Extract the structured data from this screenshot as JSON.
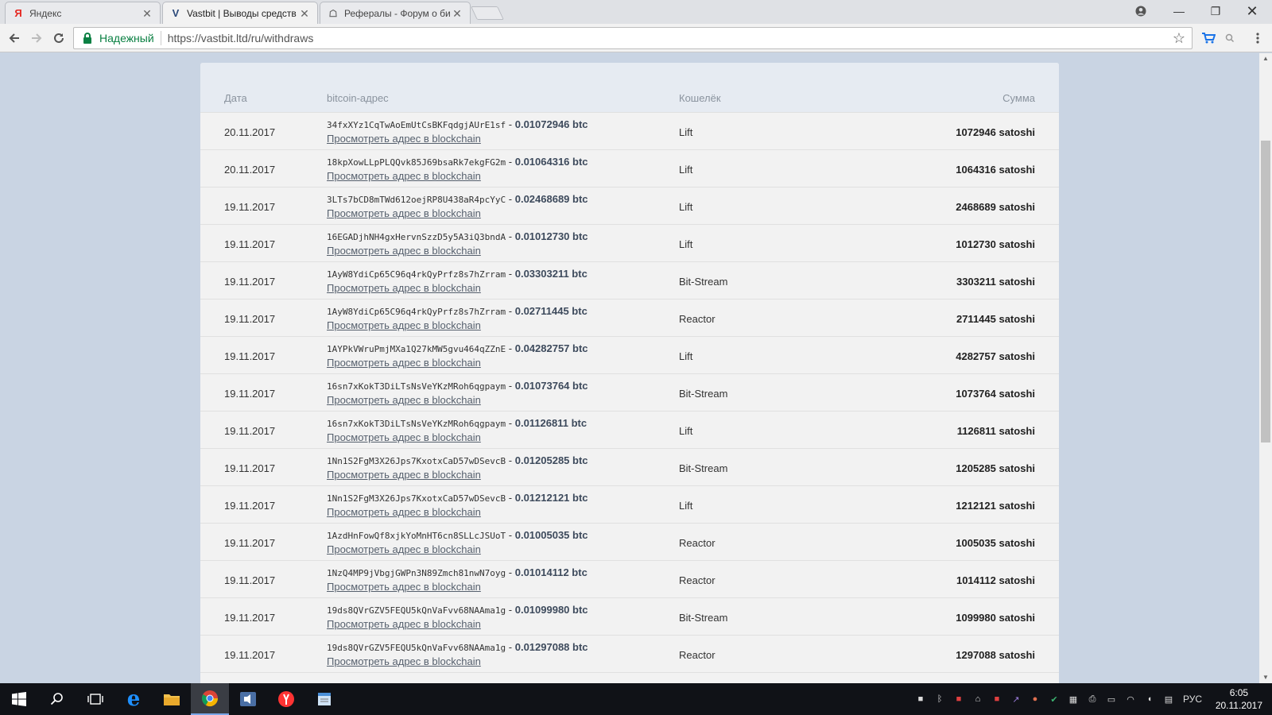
{
  "browser": {
    "tabs": [
      {
        "favicon": "Я",
        "title": "Яндекс"
      },
      {
        "favicon": "V",
        "title": "Vastbit | Выводы средств"
      },
      {
        "favicon": "☖",
        "title": "Рефералы - Форум о би"
      }
    ],
    "secure_label": "Надежный",
    "url": "https://vastbit.ltd/ru/withdraws"
  },
  "table": {
    "headers": {
      "date": "Дата",
      "address": "bitcoin-адрес",
      "wallet": "Кошелёк",
      "sum": "Сумма"
    },
    "link_label": "Просмотреть адрес в blockchain",
    "rows": [
      {
        "date": "20.11.2017",
        "address": "34fxXYz1CqTwAoEmUtCsBKFqdgjAUrE1sf",
        "btc": "0.01072946 btc",
        "wallet": "Lift",
        "sum": "1072946 satoshi"
      },
      {
        "date": "20.11.2017",
        "address": "18kpXowLLpPLQQvk85J69bsaRk7ekgFG2m",
        "btc": "0.01064316 btc",
        "wallet": "Lift",
        "sum": "1064316 satoshi"
      },
      {
        "date": "19.11.2017",
        "address": "3LTs7bCD8mTWd612oejRP8U438aR4pcYyC",
        "btc": "0.02468689 btc",
        "wallet": "Lift",
        "sum": "2468689 satoshi"
      },
      {
        "date": "19.11.2017",
        "address": "16EGADjhNH4gxHervnSzzD5y5A3iQ3bndA",
        "btc": "0.01012730 btc",
        "wallet": "Lift",
        "sum": "1012730 satoshi"
      },
      {
        "date": "19.11.2017",
        "address": "1AyW8YdiCp65C96q4rkQyPrfz8s7hZrram",
        "btc": "0.03303211 btc",
        "wallet": "Bit-Stream",
        "sum": "3303211 satoshi"
      },
      {
        "date": "19.11.2017",
        "address": "1AyW8YdiCp65C96q4rkQyPrfz8s7hZrram",
        "btc": "0.02711445 btc",
        "wallet": "Reactor",
        "sum": "2711445 satoshi"
      },
      {
        "date": "19.11.2017",
        "address": "1AYPkVWruPmjMXa1Q27kMW5gvu464qZZnE",
        "btc": "0.04282757 btc",
        "wallet": "Lift",
        "sum": "4282757 satoshi"
      },
      {
        "date": "19.11.2017",
        "address": "16sn7xKokT3DiLTsNsVeYKzMRoh6qgpaym",
        "btc": "0.01073764 btc",
        "wallet": "Bit-Stream",
        "sum": "1073764 satoshi"
      },
      {
        "date": "19.11.2017",
        "address": "16sn7xKokT3DiLTsNsVeYKzMRoh6qgpaym",
        "btc": "0.01126811 btc",
        "wallet": "Lift",
        "sum": "1126811 satoshi"
      },
      {
        "date": "19.11.2017",
        "address": "1Nn1S2FgM3X26Jps7KxotxCaD57wDSevcB",
        "btc": "0.01205285 btc",
        "wallet": "Bit-Stream",
        "sum": "1205285 satoshi"
      },
      {
        "date": "19.11.2017",
        "address": "1Nn1S2FgM3X26Jps7KxotxCaD57wDSevcB",
        "btc": "0.01212121 btc",
        "wallet": "Lift",
        "sum": "1212121 satoshi"
      },
      {
        "date": "19.11.2017",
        "address": "1AzdHnFowQf8xjkYoMnHT6cn8SLLcJSUoT",
        "btc": "0.01005035 btc",
        "wallet": "Reactor",
        "sum": "1005035 satoshi"
      },
      {
        "date": "19.11.2017",
        "address": "1NzQ4MP9jVbgjGWPn3N89Zmch81nwN7oyg",
        "btc": "0.01014112 btc",
        "wallet": "Reactor",
        "sum": "1014112 satoshi"
      },
      {
        "date": "19.11.2017",
        "address": "19ds8QVrGZV5FEQU5kQnVaFvv68NAAma1g",
        "btc": "0.01099980 btc",
        "wallet": "Bit-Stream",
        "sum": "1099980 satoshi"
      },
      {
        "date": "19.11.2017",
        "address": "19ds8QVrGZV5FEQU5kQnVaFvv68NAAma1g",
        "btc": "0.01297088 btc",
        "wallet": "Reactor",
        "sum": "1297088 satoshi"
      },
      {
        "date": "",
        "address": "",
        "btc": "",
        "wallet": "",
        "sum": ""
      }
    ]
  },
  "taskbar": {
    "language": "РУС",
    "time": "6:05",
    "date": "20.11.2017"
  },
  "colors": {
    "page_bg": "#c9d4e3",
    "card_bg": "#f0f0f0",
    "secure_green": "#0b8043",
    "taskbar_bg": "#101217"
  }
}
